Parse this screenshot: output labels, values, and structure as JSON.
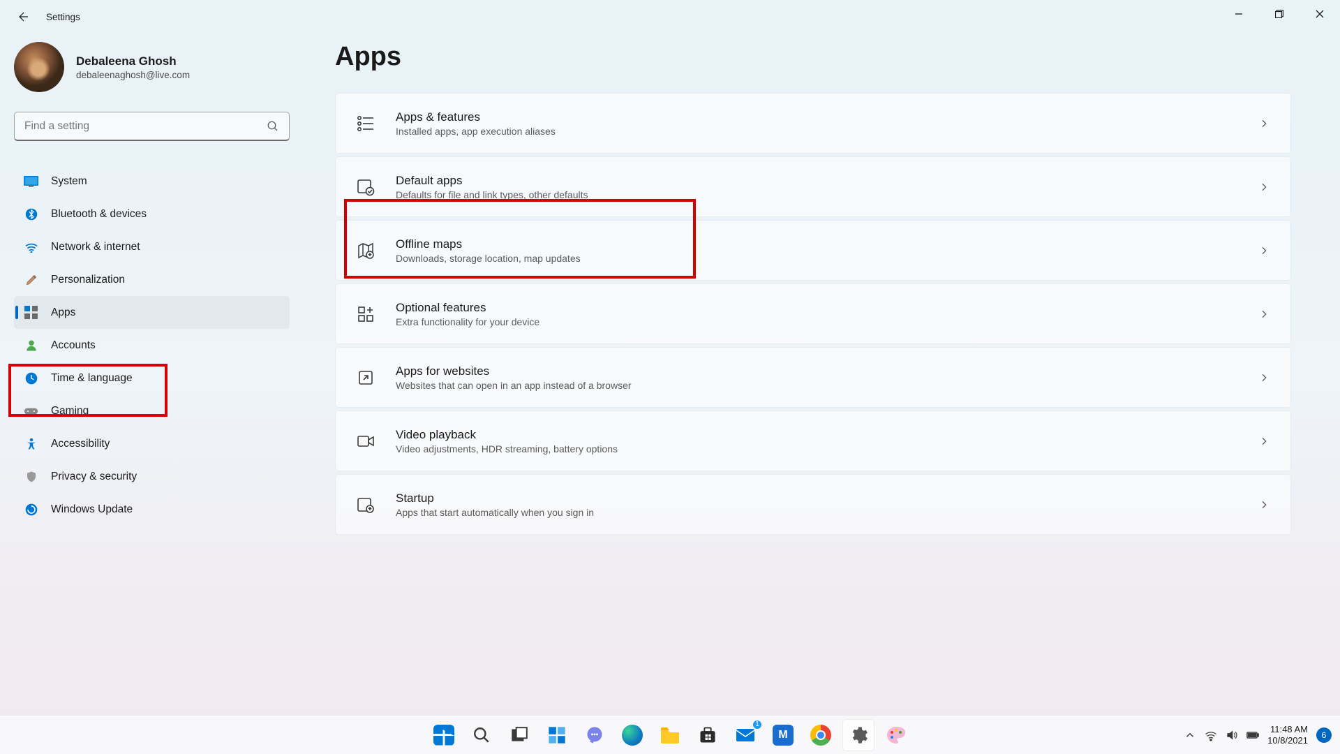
{
  "window": {
    "title": "Settings"
  },
  "profile": {
    "name": "Debaleena Ghosh",
    "email": "debaleenaghosh@live.com"
  },
  "search": {
    "placeholder": "Find a setting"
  },
  "sidebar": {
    "items": [
      {
        "label": "System"
      },
      {
        "label": "Bluetooth & devices"
      },
      {
        "label": "Network & internet"
      },
      {
        "label": "Personalization"
      },
      {
        "label": "Apps"
      },
      {
        "label": "Accounts"
      },
      {
        "label": "Time & language"
      },
      {
        "label": "Gaming"
      },
      {
        "label": "Accessibility"
      },
      {
        "label": "Privacy & security"
      },
      {
        "label": "Windows Update"
      }
    ]
  },
  "page": {
    "title": "Apps"
  },
  "cards": [
    {
      "title": "Apps & features",
      "sub": "Installed apps, app execution aliases"
    },
    {
      "title": "Default apps",
      "sub": "Defaults for file and link types, other defaults"
    },
    {
      "title": "Offline maps",
      "sub": "Downloads, storage location, map updates"
    },
    {
      "title": "Optional features",
      "sub": "Extra functionality for your device"
    },
    {
      "title": "Apps for websites",
      "sub": "Websites that can open in an app instead of a browser"
    },
    {
      "title": "Video playback",
      "sub": "Video adjustments, HDR streaming, battery options"
    },
    {
      "title": "Startup",
      "sub": "Apps that start automatically when you sign in"
    }
  ],
  "clock": {
    "time": "11:48 AM",
    "date": "10/8/2021"
  },
  "notifications": {
    "count": "6"
  },
  "mail_badge": "1",
  "colors": {
    "accent": "#0067c0",
    "highlight": "#d60000"
  }
}
